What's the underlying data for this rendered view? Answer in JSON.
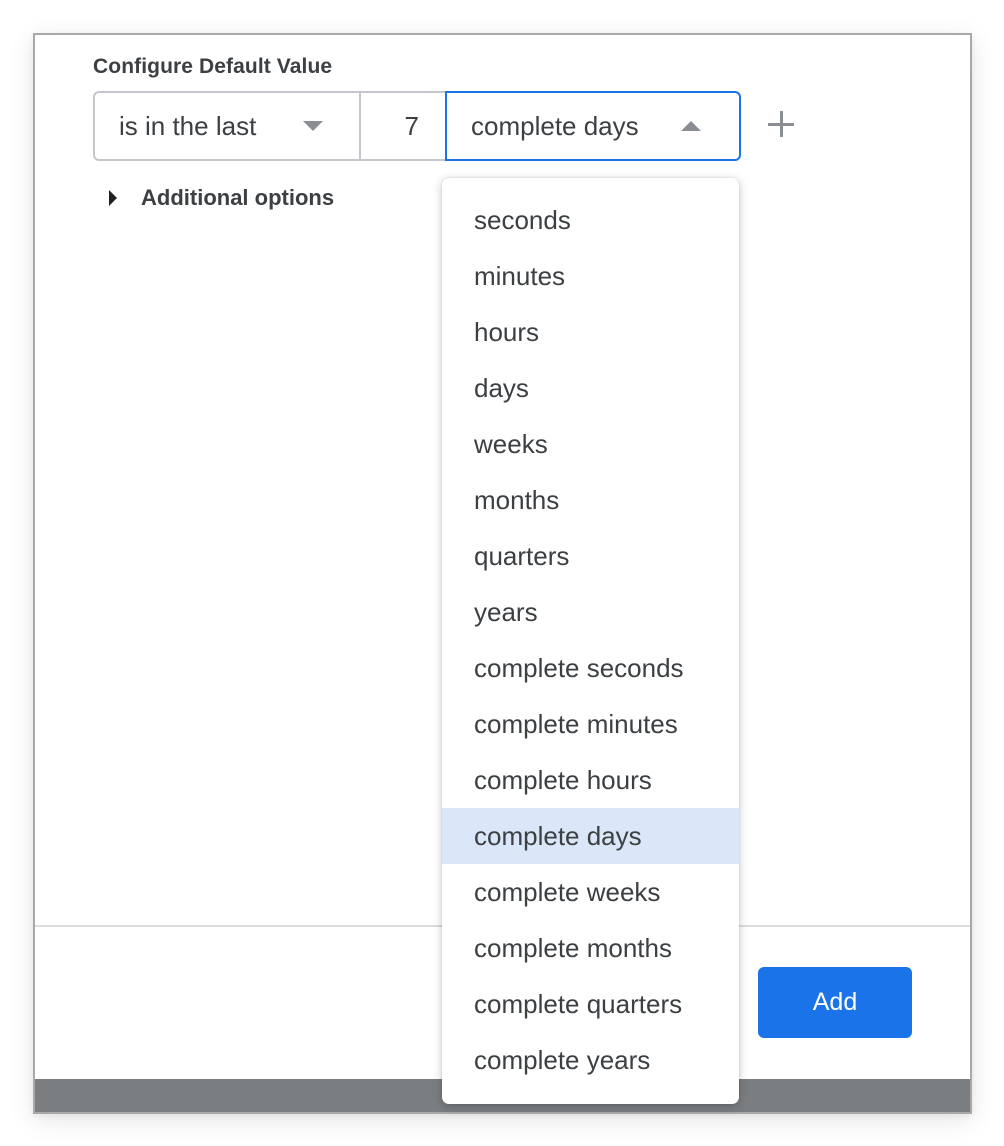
{
  "form": {
    "label": "Configure Default Value",
    "operator_select": {
      "value": "is in the last",
      "icon": "caret-down-icon"
    },
    "number_input": {
      "value": "7"
    },
    "unit_select": {
      "value": "complete days",
      "icon": "caret-up-icon",
      "open": true
    },
    "add_condition_icon": "plus-icon",
    "additional_options": {
      "label": "Additional options",
      "icon": "caret-right-icon",
      "expanded": false
    }
  },
  "dropdown": {
    "options": [
      {
        "label": "seconds"
      },
      {
        "label": "minutes"
      },
      {
        "label": "hours"
      },
      {
        "label": "days"
      },
      {
        "label": "weeks"
      },
      {
        "label": "months"
      },
      {
        "label": "quarters"
      },
      {
        "label": "years"
      },
      {
        "label": "complete seconds"
      },
      {
        "label": "complete minutes"
      },
      {
        "label": "complete hours"
      },
      {
        "label": "complete days",
        "selected": true
      },
      {
        "label": "complete weeks"
      },
      {
        "label": "complete months"
      },
      {
        "label": "complete quarters"
      },
      {
        "label": "complete years"
      }
    ],
    "selected_index": 11
  },
  "footer": {
    "add_label": "Add"
  },
  "colors": {
    "accent": "#1a73e8",
    "selected_option_bg": "#d9e7f8",
    "text": "#3c4043"
  }
}
